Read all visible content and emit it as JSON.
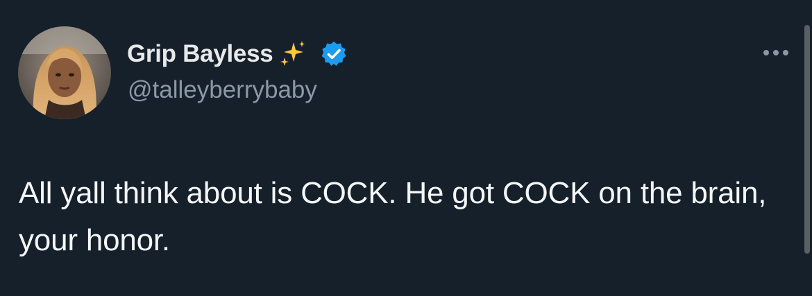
{
  "tweet": {
    "author": {
      "display_name": "Grip Bayless",
      "handle": "@talleyberrybaby",
      "name_emoji": "sparkles-icon",
      "verified": true
    },
    "text": "All yall think about is COCK. He got COCK on the brain, your honor."
  },
  "colors": {
    "background": "#16202a",
    "primary_text": "#e7e9ea",
    "secondary_text": "#8b98a5",
    "verified_badge": "#1d9bf0",
    "sparkles": "#ffc83d"
  }
}
